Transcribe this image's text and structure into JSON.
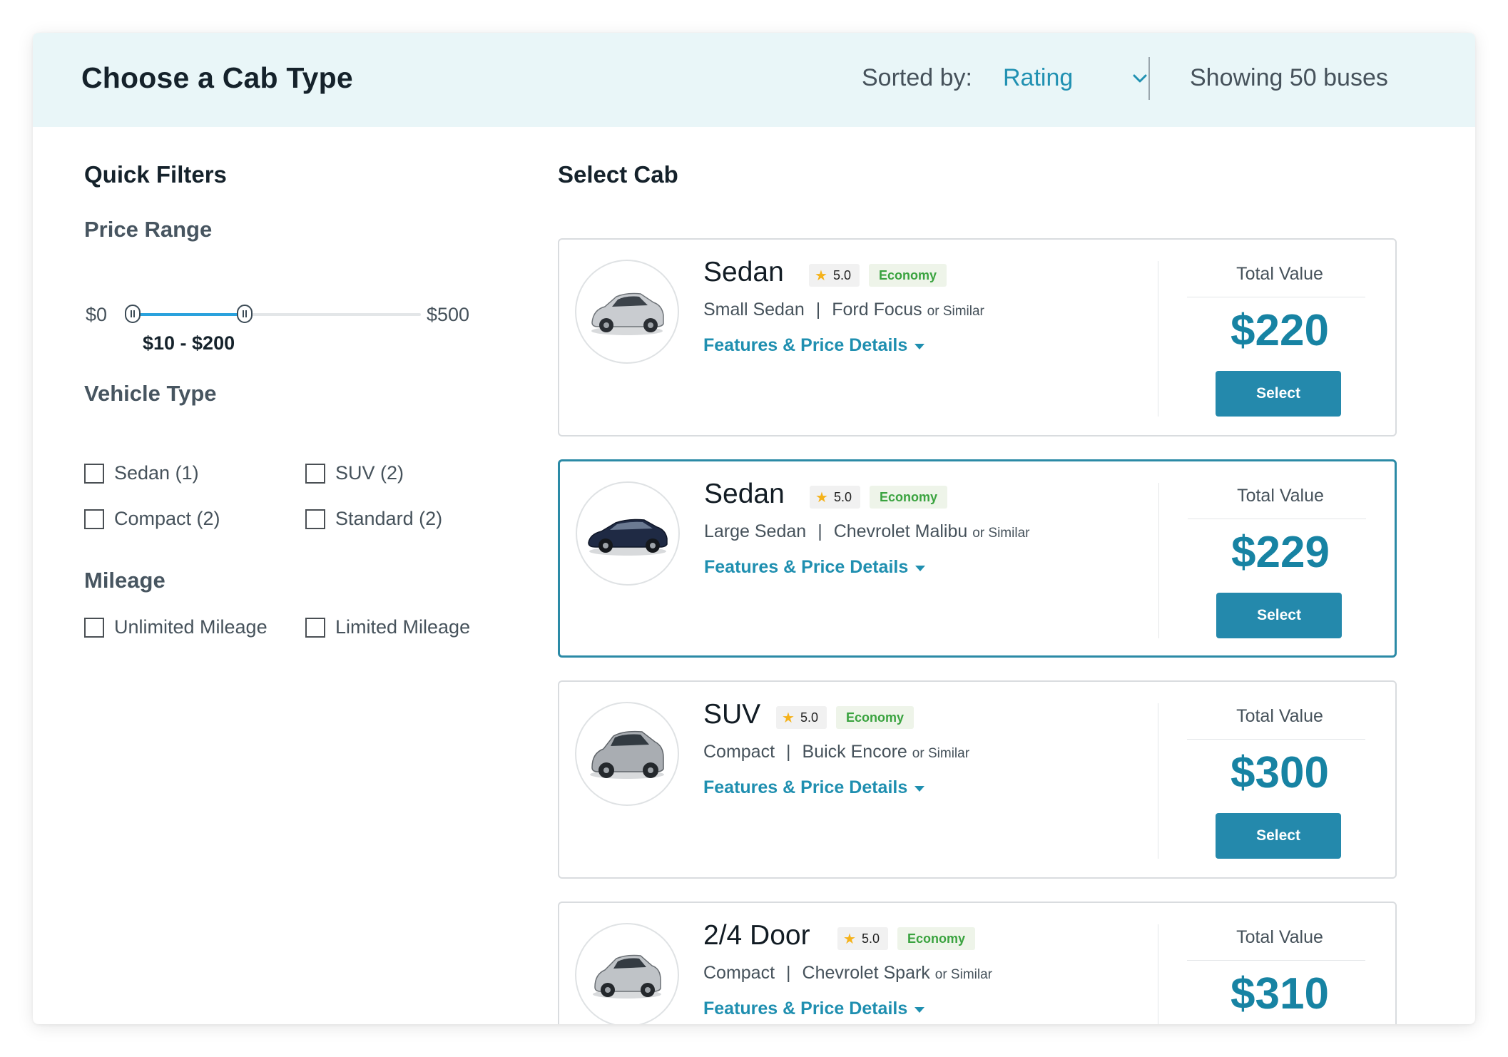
{
  "header": {
    "title": "Choose a Cab Type",
    "sorted_by_label": "Sorted by:",
    "sorted_by_value": "Rating",
    "showing": "Showing 50 buses"
  },
  "filters": {
    "title": "Quick Filters",
    "price_range": {
      "title": "Price Range",
      "min_label": "$0",
      "max_label": "$500",
      "min": 0,
      "max": 500,
      "low": 10,
      "high": 200,
      "selected_label": "$10 - $200"
    },
    "vehicle_type": {
      "title": "Vehicle Type",
      "options": [
        "Sedan (1)",
        "SUV (2)",
        "Compact (2)",
        "Standard (2)"
      ]
    },
    "mileage": {
      "title": "Mileage",
      "options": [
        "Unlimited Mileage",
        "Limited Mileage"
      ]
    }
  },
  "results": {
    "title": "Select Cab",
    "total_label": "Total Value",
    "select_label": "Select",
    "details_label": "Features & Price Details",
    "similar_label": "or Similar",
    "cards": [
      {
        "name": "Sedan",
        "rating": "5.0",
        "class": "Economy",
        "size": "Small Sedan",
        "model": "Ford Focus",
        "price": "$220",
        "color": "#c9ccd0"
      },
      {
        "name": "Sedan",
        "rating": "5.0",
        "class": "Economy",
        "size": "Large Sedan",
        "model": "Chevrolet Malibu",
        "price": "$229",
        "color": "#1f2a44"
      },
      {
        "name": "SUV",
        "rating": "5.0",
        "class": "Economy",
        "size": "Compact",
        "model": "Buick Encore",
        "price": "$300",
        "color": "#a9adb2"
      },
      {
        "name": "2/4 Door",
        "rating": "5.0",
        "class": "Economy",
        "size": "Compact",
        "model": "Chevrolet Spark",
        "price": "$310",
        "color": "#bfc3c7"
      }
    ]
  },
  "colors": {
    "accent": "#2191b2",
    "header_bg": "#e9f6f8",
    "button": "#2489ac",
    "badge_green": "#3aa33f",
    "star": "#f5b21a"
  }
}
